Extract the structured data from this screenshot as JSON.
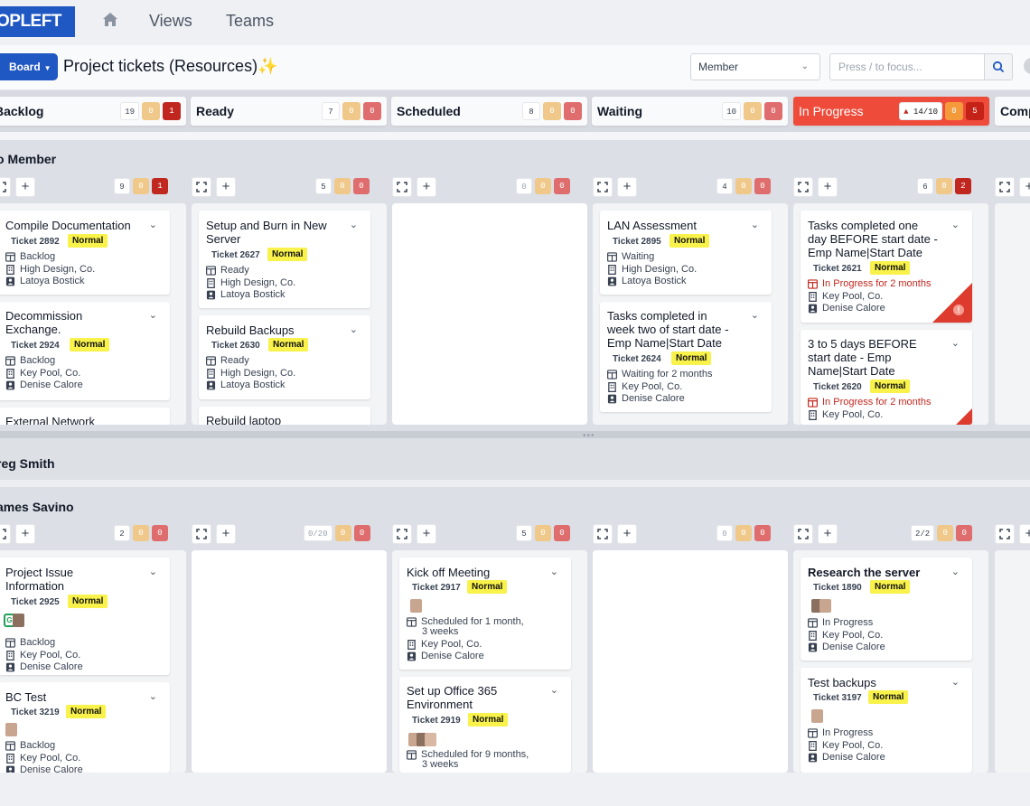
{
  "nav": {
    "logo": "OPLEFT",
    "links": [
      "Views",
      "Teams"
    ]
  },
  "header": {
    "board_label": "Board",
    "title": "Project tickets (Resources)✨",
    "member_select": "Member",
    "search_placeholder": "Press / to focus..."
  },
  "columns": [
    {
      "name": "Backlog",
      "count": "19",
      "y": "0",
      "r": "1"
    },
    {
      "name": "Ready",
      "count": "7",
      "y": "0",
      "r": "0"
    },
    {
      "name": "Scheduled",
      "count": "8",
      "y": "0",
      "r": "0"
    },
    {
      "name": "Waiting",
      "count": "10",
      "y": "0",
      "r": "0"
    },
    {
      "name": "In Progress",
      "count": "14/10",
      "y": "0",
      "r": "5"
    },
    {
      "name": "Comp"
    }
  ],
  "groups": {
    "no_member": {
      "title": "o Member",
      "counts": [
        {
          "c": "9",
          "y": "0",
          "r": "1"
        },
        {
          "c": "5",
          "y": "0",
          "r": "0"
        },
        {
          "c": "0",
          "y": "0",
          "r": "0"
        },
        {
          "c": "4",
          "y": "0",
          "r": "0"
        },
        {
          "c": "6",
          "y": "0",
          "r": "2"
        }
      ]
    },
    "greg": {
      "title": "reg Smith"
    },
    "james": {
      "title": "ames Savino",
      "counts": [
        {
          "c": "2",
          "y": "0",
          "r": "0"
        },
        {
          "c": "0/20",
          "y": "0",
          "r": "0"
        },
        {
          "c": "5",
          "y": "0",
          "r": "0"
        },
        {
          "c": "0",
          "y": "0",
          "r": "0"
        },
        {
          "c": "2/2",
          "y": "0",
          "r": "0"
        }
      ]
    }
  },
  "cards": {
    "c1": {
      "title": "Compile Documentation",
      "ticket": "Ticket 2892",
      "priority": "Normal",
      "status": "Backlog",
      "company": "High Design, Co.",
      "person": "Latoya Bostick"
    },
    "c2": {
      "title1": "Decommission",
      "title2": "Exchange.",
      "ticket": "Ticket 2924",
      "priority": "Normal",
      "status": "Backlog",
      "company": "Key Pool, Co.",
      "person": "Denise Calore"
    },
    "c3": {
      "title": "External Network"
    },
    "c4": {
      "title1": "Setup and Burn in New",
      "title2": "Server",
      "ticket": "Ticket 2627",
      "priority": "Normal",
      "status": "Ready",
      "company": "High Design, Co.",
      "person": "Latoya Bostick"
    },
    "c5": {
      "title": "Rebuild Backups",
      "ticket": "Ticket 2630",
      "priority": "Normal",
      "status": "Ready",
      "company": "High Design, Co.",
      "person": "Latoya Bostick"
    },
    "c6": {
      "title": "Rebuild laptop"
    },
    "c7": {
      "title": "LAN Assessment",
      "ticket": "Ticket 2895",
      "priority": "Normal",
      "status": "Waiting",
      "company": "High Design, Co.",
      "person": "Latoya Bostick"
    },
    "c8": {
      "title1": "Tasks completed in",
      "title2": "week two of start date -",
      "title3": "Emp Name|Start Date",
      "ticket": "Ticket 2624",
      "priority": "Normal",
      "status": "Waiting for 2 months",
      "company": "Key Pool, Co.",
      "person": "Denise Calore"
    },
    "c9": {
      "title1": "Tasks completed one",
      "title2": "day BEFORE start date -",
      "title3": "Emp Name|Start Date",
      "ticket": "Ticket 2621",
      "priority": "Normal",
      "status": "In Progress for 2 months",
      "company": "Key Pool, Co.",
      "person": "Denise Calore"
    },
    "c10": {
      "title1": "3 to 5 days BEFORE",
      "title2": "start date - Emp",
      "title3": "Name|Start Date",
      "ticket": "Ticket 2620",
      "priority": "Normal",
      "status": "In Progress for 2 months",
      "company": "Key Pool, Co."
    },
    "j1": {
      "title1": "Project Issue",
      "title2": "Information",
      "ticket": "Ticket 2925",
      "priority": "Normal",
      "status": "Backlog",
      "company": "Key Pool, Co.",
      "person": "Denise Calore"
    },
    "j2": {
      "title": "BC Test",
      "ticket": "Ticket 3219",
      "priority": "Normal",
      "status": "Backlog",
      "company": "Key Pool, Co.",
      "person": "Denise Calore"
    },
    "j3": {
      "title": "Kick off Meeting",
      "ticket": "Ticket 2917",
      "priority": "Normal",
      "status1": "Scheduled for 1 month,",
      "status2": "3 weeks",
      "company": "Key Pool, Co.",
      "person": "Denise Calore"
    },
    "j4": {
      "title1": "Set up Office 365",
      "title2": "Environment",
      "ticket": "Ticket 2919",
      "priority": "Normal",
      "status1": "Scheduled for 9 months,",
      "status2": "3 weeks"
    },
    "j5": {
      "title": "Research the server",
      "ticket": "Ticket 1890",
      "priority": "Normal",
      "status": "In Progress",
      "company": "Key Pool, Co.",
      "person": "Denise Calore"
    },
    "j6": {
      "title": "Test backups",
      "ticket": "Ticket 3197",
      "priority": "Normal",
      "status": "In Progress",
      "company": "Key Pool, Co.",
      "person": "Denise Calore"
    }
  }
}
